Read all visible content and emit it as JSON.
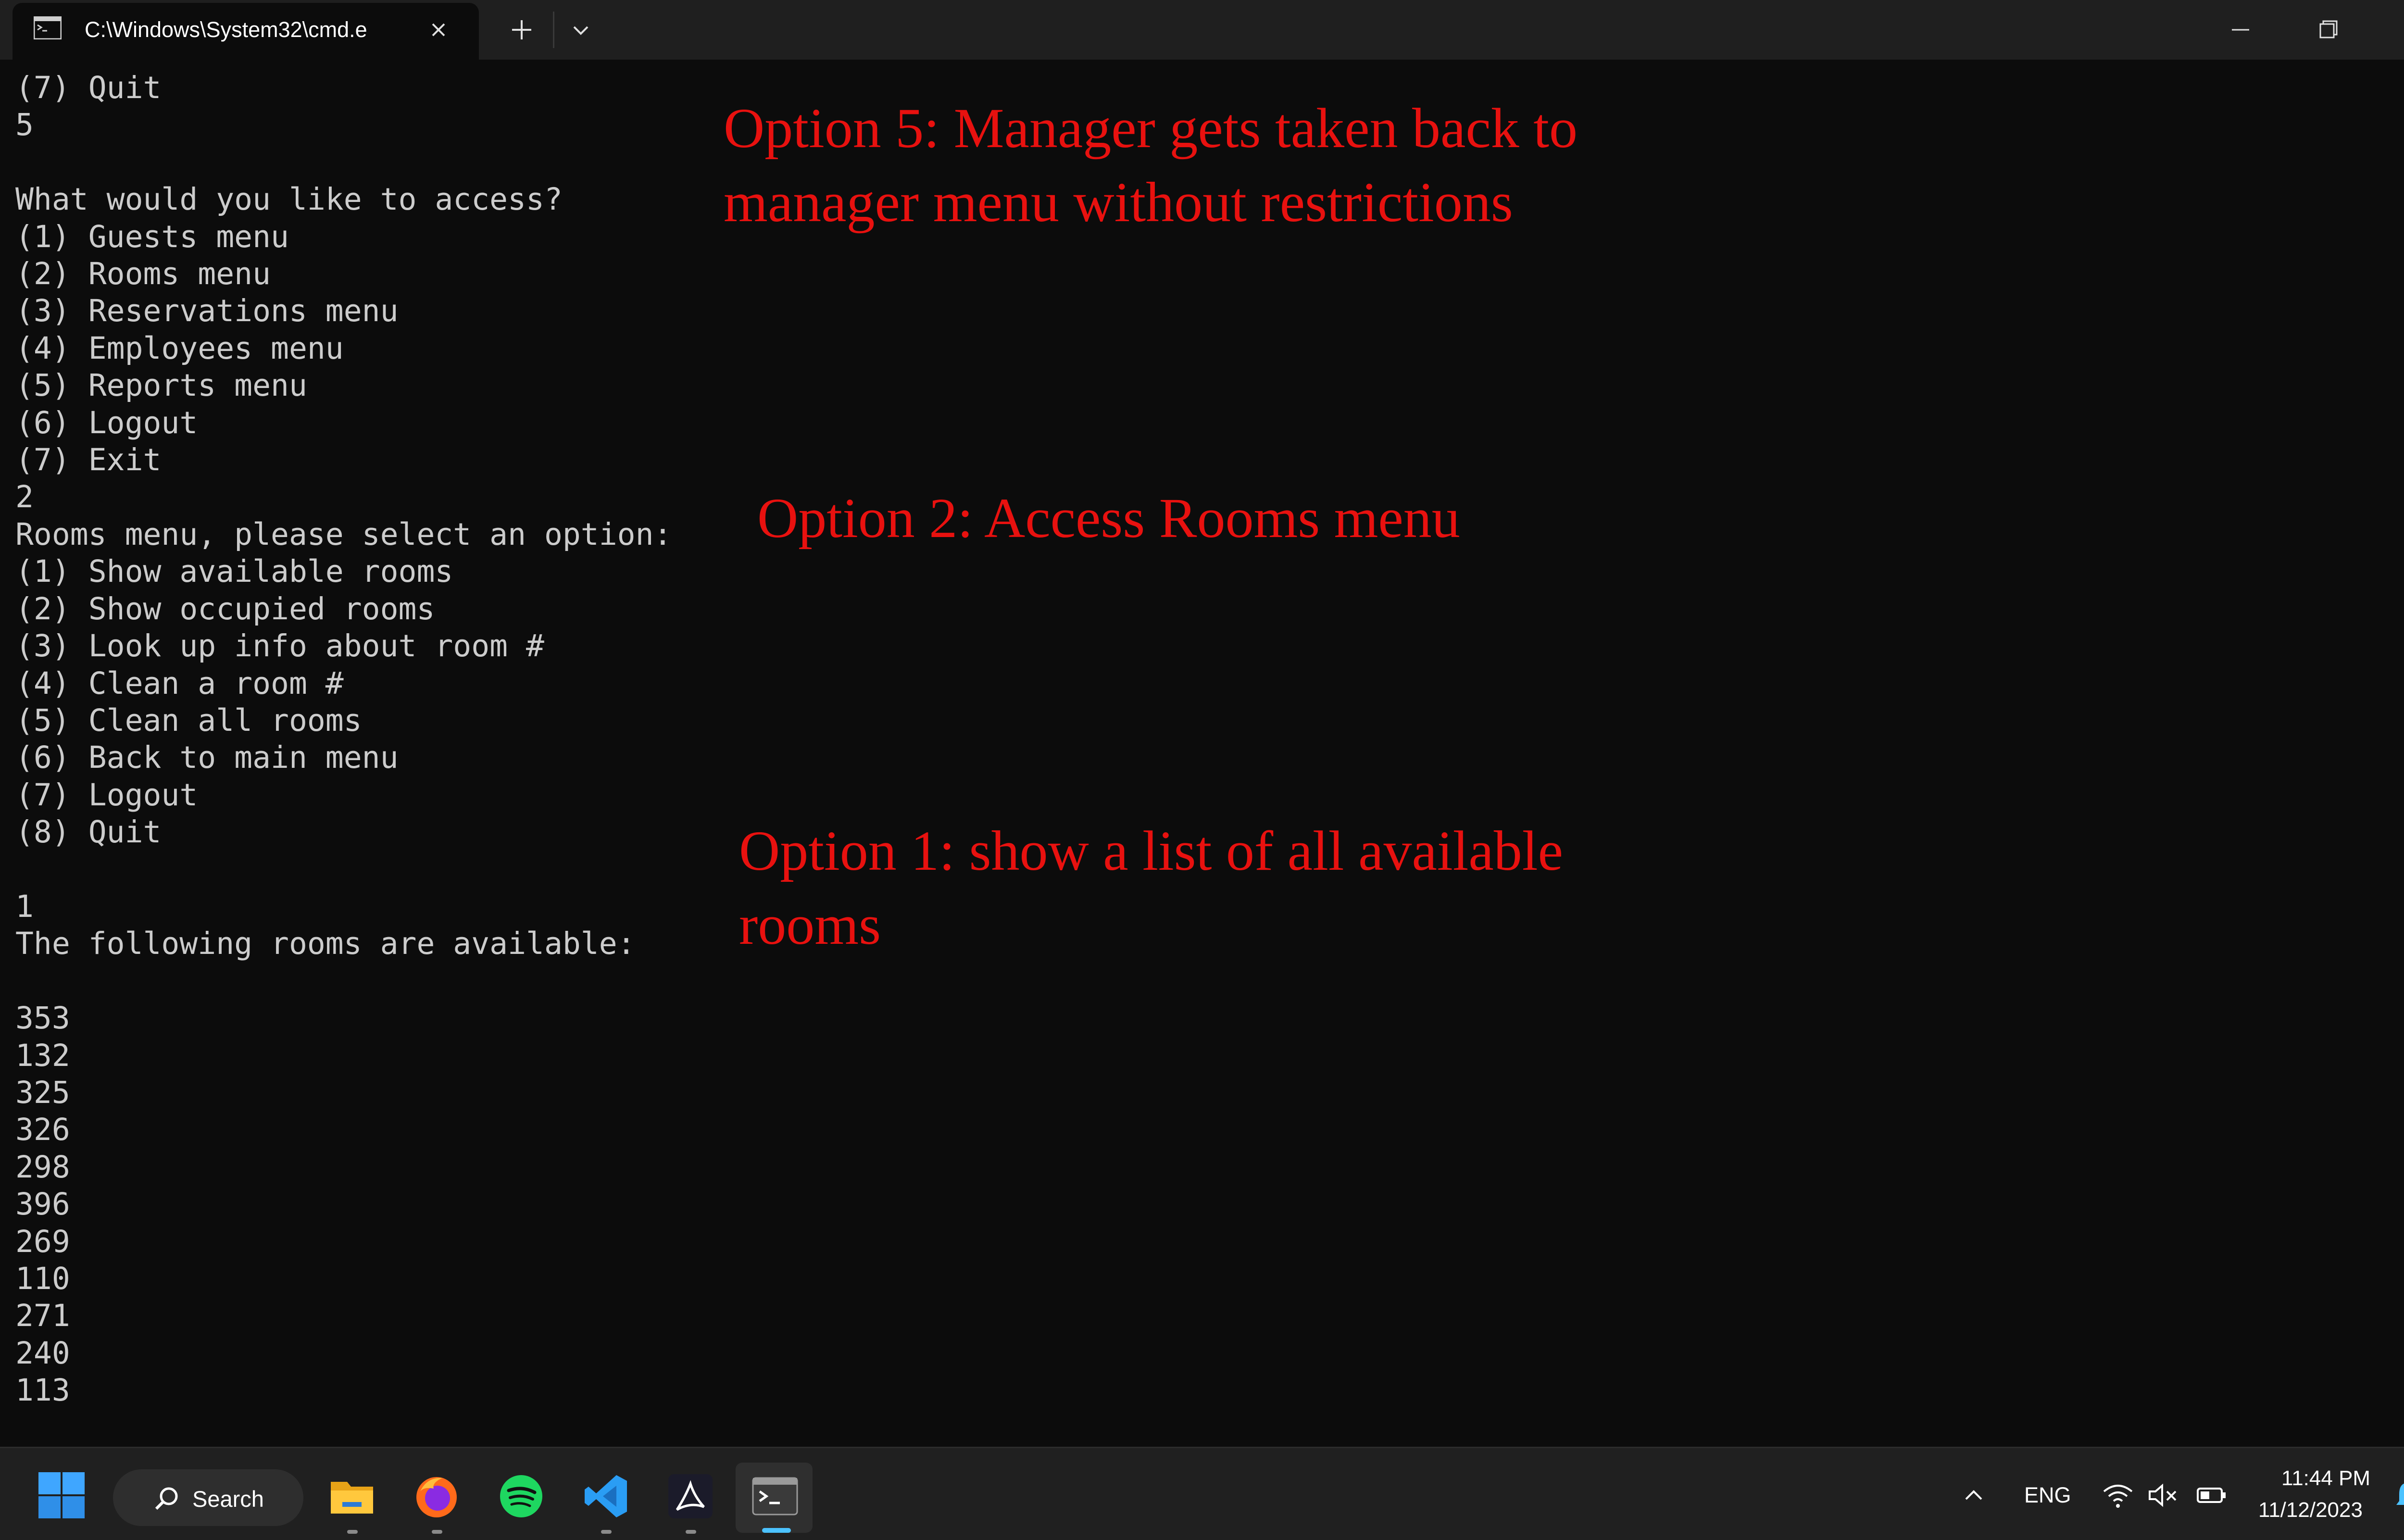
{
  "window": {
    "tab_title": "C:\\Windows\\System32\\cmd.e"
  },
  "terminal": {
    "lines": [
      "(7) Quit",
      "5",
      "",
      "What would you like to access?",
      "(1) Guests menu",
      "(2) Rooms menu",
      "(3) Reservations menu",
      "(4) Employees menu",
      "(5) Reports menu",
      "(6) Logout",
      "(7) Exit",
      "2",
      "Rooms menu, please select an option:",
      "(1) Show available rooms",
      "(2) Show occupied rooms",
      "(3) Look up info about room #",
      "(4) Clean a room #",
      "(5) Clean all rooms",
      "(6) Back to main menu",
      "(7) Logout",
      "(8) Quit",
      "",
      "1",
      "The following rooms are available:",
      "",
      "353",
      "132",
      "325",
      "326",
      "298",
      "396",
      "269",
      "110",
      "271",
      "240",
      "113"
    ]
  },
  "annotations": {
    "option5": "Option 5: Manager gets taken back to\nmanager menu without restrictions",
    "option2": "Option 2: Access Rooms menu",
    "option1": "Option 1: show a list of all available\nrooms"
  },
  "taskbar": {
    "search_label": "Search",
    "icons": [
      "windows-start-icon",
      "search-icon",
      "file-explorer-icon",
      "firefox-icon",
      "spotify-icon",
      "vscode-icon",
      "acrobat-icon",
      "terminal-icon"
    ],
    "tray": {
      "language": "ENG",
      "time": "11:44 PM",
      "date": "11/12/2023"
    }
  },
  "colors": {
    "annotation": "#e8110f",
    "terminal_bg": "#0c0c0c",
    "terminal_text": "#cccccc",
    "accent": "#4cc2ff"
  }
}
